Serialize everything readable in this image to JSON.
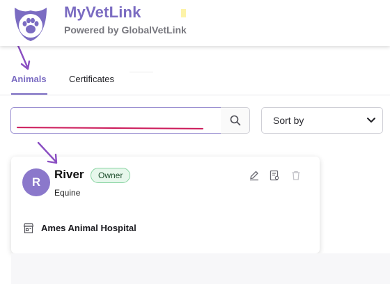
{
  "header": {
    "app_title": "MyVetLink",
    "subtitle": "Powered by GlobalVetLink",
    "logo_icon": "paw-shield-logo",
    "accent": "#7b6cc2"
  },
  "tabs": [
    {
      "label": "Animals",
      "active": true
    },
    {
      "label": "Certificates",
      "active": false
    }
  ],
  "search": {
    "value": "",
    "placeholder": "",
    "button_icon": "search-icon"
  },
  "sort": {
    "label": "Sort by",
    "icon": "chevron-down-icon"
  },
  "animal_card": {
    "initial": "R",
    "name": "River",
    "badge": "Owner",
    "species": "Equine",
    "clinic": "Ames Animal Hospital",
    "actions": [
      "pencil-icon",
      "certificate-icon",
      "trash-icon"
    ],
    "avatar_color": "#8b78cb",
    "badge_color": "#e7f7ec"
  }
}
